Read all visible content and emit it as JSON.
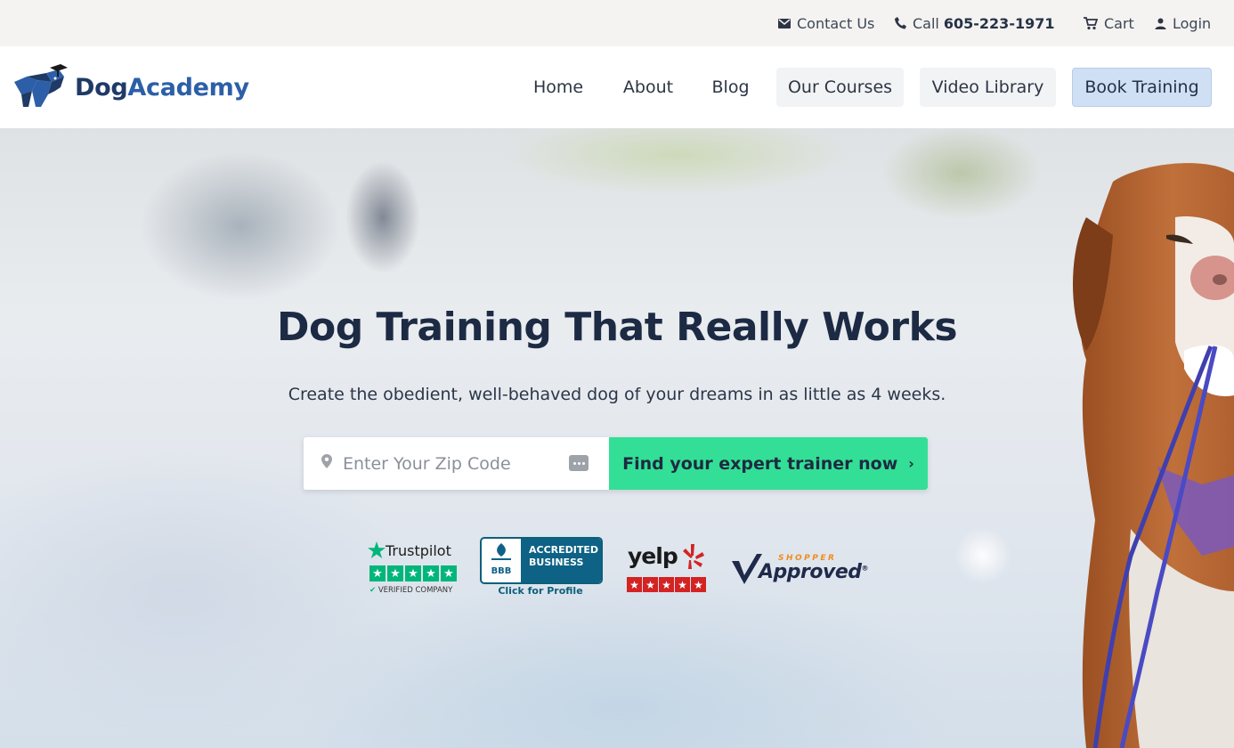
{
  "topbar": {
    "contact": {
      "label": "Contact Us",
      "icon": "envelope-icon"
    },
    "call": {
      "prefix": "Call",
      "phone": "605-223-1971",
      "icon": "phone-icon"
    },
    "cart": {
      "label": "Cart",
      "icon": "cart-icon"
    },
    "login": {
      "label": "Login",
      "icon": "user-icon"
    }
  },
  "brand": {
    "name_part1": "Dog",
    "name_part2": "Academy",
    "logo_icon": "dog-graduate-logo"
  },
  "nav": {
    "items": [
      {
        "label": "Home"
      },
      {
        "label": "About"
      },
      {
        "label": "Blog"
      },
      {
        "label": "Our Courses"
      },
      {
        "label": "Video Library"
      },
      {
        "label": "Book Training"
      }
    ]
  },
  "hero": {
    "headline": "Dog Training That Really Works",
    "subline": "Create the obedient, well-behaved dog of your dreams in as little as 4 weeks.",
    "zip_placeholder": "Enter Your Zip Code",
    "zip_value": "",
    "cta_label": "Find your expert trainer now",
    "cta_chevron": "›"
  },
  "badges": {
    "trustpilot": {
      "name": "Trustpilot",
      "verified": "VERIFIED COMPANY",
      "stars": 5
    },
    "bbb": {
      "abbr": "BBB",
      "line1": "ACCREDITED",
      "line2": "BUSINESS",
      "link": "Click for Profile"
    },
    "yelp": {
      "name": "yelp",
      "stars": 5
    },
    "shopper_approved": {
      "top": "SHOPPER",
      "main": "Approved"
    }
  },
  "colors": {
    "cta_green": "#33df96",
    "brand_navy": "#1f3a66",
    "brand_blue": "#2c5fa8",
    "book_training_bg": "#cfe0f4",
    "trustpilot_green": "#00b67a",
    "yelp_red": "#d32323",
    "bbb_blue": "#0d6285"
  }
}
